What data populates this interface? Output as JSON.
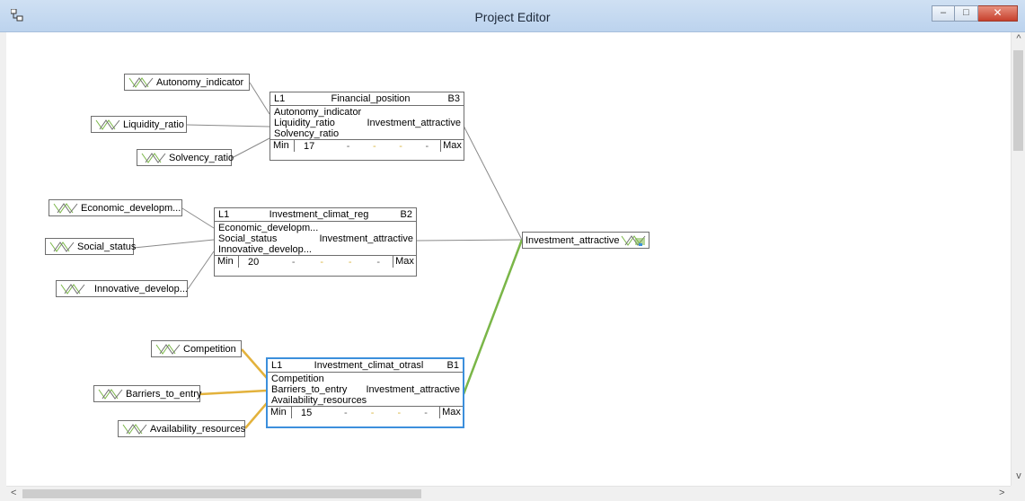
{
  "window": {
    "title": "Project Editor",
    "minimize_glyph": "–",
    "maximize_glyph": "□",
    "close_glyph": "✕"
  },
  "colors": {
    "plain_link": "#8a8a8a",
    "active_input_link": "#e3b23c",
    "active_output_link": "#7ab648",
    "selection_border": "#3c8fdc"
  },
  "inputs": {
    "autonomy": "Autonomy_indicator",
    "liquidity": "Liquidity_ratio",
    "solvency": "Solvency_ratio",
    "economic": "Economic_developm...",
    "social": "Social_status",
    "innovative": "Innovative_develop...",
    "competition": "Competition",
    "barriers": "Barriers_to_entry",
    "availability": "Availability_resources"
  },
  "blocks": [
    {
      "level": "L1",
      "name": "Financial_position",
      "id": "B3",
      "rows": [
        "Autonomy_indicator",
        "Liquidity_ratio",
        "Solvency_ratio"
      ],
      "output": "Investment_attractive",
      "min_label": "Min",
      "value": "17",
      "dash": "-",
      "max_label": "Max"
    },
    {
      "level": "L1",
      "name": "Investment_climat_reg",
      "id": "B2",
      "rows": [
        "Economic_developm...",
        "Social_status",
        "Innovative_develop..."
      ],
      "output": "Investment_attractive",
      "min_label": "Min",
      "value": "20",
      "dash": "-",
      "max_label": "Max"
    },
    {
      "level": "L1",
      "name": "Investment_climat_otrasl",
      "id": "B1",
      "rows": [
        "Competition",
        "Barriers_to_entry",
        "Availability_resources"
      ],
      "output": "Investment_attractive",
      "min_label": "Min",
      "value": "15",
      "dash": "-",
      "max_label": "Max"
    }
  ],
  "output_node": {
    "label": "Investment_attractive"
  },
  "scrollbars": {
    "up_glyph": "^",
    "down_glyph": "v",
    "left_glyph": "<",
    "right_glyph": ">"
  }
}
